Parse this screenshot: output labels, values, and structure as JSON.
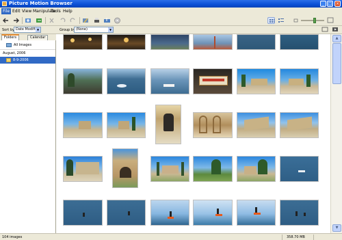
{
  "window": {
    "title": "Picture Motion Browser"
  },
  "menu": [
    "File",
    "Edit",
    "View",
    "Manipulate",
    "Tools",
    "Help"
  ],
  "sortbar": {
    "sort_label": "Sort by:",
    "sort_value": "Date Modified",
    "group_label": "Group by:",
    "group_value": "(None)"
  },
  "left_pane": {
    "tabs": [
      "Folders",
      "Calendar"
    ],
    "all_images": "All Images",
    "month": "August, 2006",
    "folder": "8-9-2006"
  },
  "status": {
    "count": "104 images",
    "size": "358.70 MB"
  },
  "icons": {
    "toolbar": [
      "back-icon",
      "forward-icon",
      "import-icon",
      "export-icon",
      "delete-icon",
      "rotate-left-icon",
      "rotate-right-icon",
      "edit-icon",
      "print-icon",
      "upload-icon",
      "burn-icon"
    ],
    "view": [
      "thumbnail-view-icon",
      "details-view-icon",
      "zoom-out-icon",
      "zoom-in-icon",
      "single-view-icon",
      "slideshow-icon"
    ]
  }
}
